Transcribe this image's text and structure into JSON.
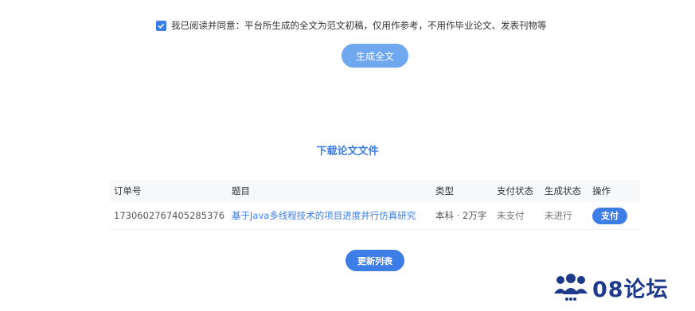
{
  "agreement": {
    "checked": true,
    "text": "我已阅读并同意：平台所生成的全文为范文初稿，仅用作参考，不用作毕业论文、发表刊物等"
  },
  "generate_button": "生成全文",
  "section_title": "下载论文文件",
  "table": {
    "headers": [
      "订单号",
      "题目",
      "类型",
      "支付状态",
      "生成状态",
      "操作"
    ],
    "rows": [
      {
        "order_no": "1730602767405285376",
        "title": "基于Java多线程技术的项目进度并行仿真研究",
        "type": "本科 · 2万字",
        "pay_status": "未支付",
        "gen_status": "未进行",
        "action": "支付"
      }
    ]
  },
  "refresh_button": "更新列表",
  "watermark": {
    "text": "08论坛",
    "icon": "users-group-icon",
    "color": "#1e3a8a"
  },
  "colors": {
    "accent": "#3d7ee6",
    "accent_light": "#6fa8ee"
  }
}
